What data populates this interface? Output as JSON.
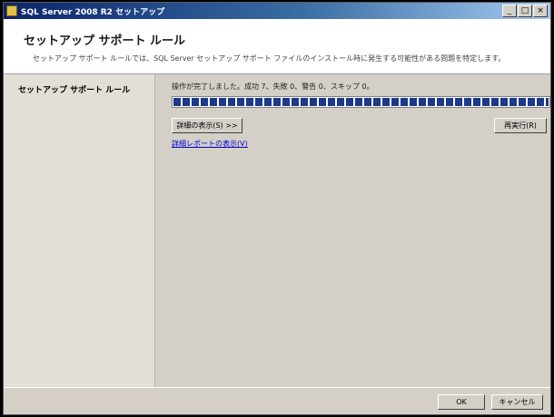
{
  "window": {
    "title": "SQL Server 2008 R2 セットアップ",
    "controls": {
      "minimize": "_",
      "maximize": "□",
      "close": "×"
    }
  },
  "header": {
    "title": "セットアップ サポート ルール",
    "description": "セットアップ サポート ルールでは、SQL Server セットアップ サポート ファイルのインストール時に発生する可能性がある問題を特定します。"
  },
  "sidebar": {
    "items": [
      {
        "label": "セットアップ サポート ルール"
      }
    ]
  },
  "main": {
    "status_text": "操作が完了しました。成功 7、失敗 0、警告 0、スキップ 0。",
    "progress": 1.0,
    "show_details_button": "詳細の表示(S) >>",
    "rerun_button": "再実行(R)",
    "report_link": "詳細レポートの表示(V)"
  },
  "footer": {
    "ok_button": "OK",
    "cancel_button": "キャンセル"
  },
  "colors": {
    "progress_fill": "#1c3a8a",
    "title_gradient_start": "#0a246a",
    "title_gradient_end": "#a6caf0"
  }
}
